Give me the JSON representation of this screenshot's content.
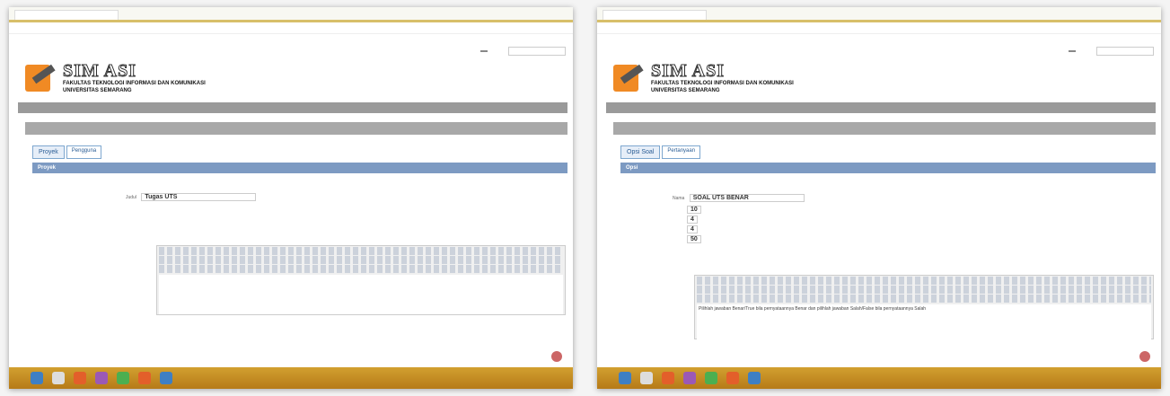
{
  "left": {
    "site_title": "SIM ASI",
    "faculty_line1": "FAKULTAS TEKNOLOGI INFORMASI DAN KOMUNIKASI",
    "faculty_line2": "UNIVERSITAS SEMARANG",
    "section_title": "Proyek",
    "tabs": [
      "Proyek",
      "Pengguna"
    ],
    "fields": {
      "name_label": "Judul",
      "name_value": "Tugas UTS"
    }
  },
  "right": {
    "site_title": "SIM ASI",
    "faculty_line1": "FAKULTAS TEKNOLOGI INFORMASI DAN KOMUNIKASI",
    "faculty_line2": "UNIVERSITAS SEMARANG",
    "section_title": "Opsi",
    "tabs": [
      "Opsi Soal",
      "Pertanyaan"
    ],
    "fields": {
      "name_label": "Nama",
      "name_value": "SOAL UTS BENAR",
      "val1": "10",
      "val2": "4",
      "val3": "4",
      "val4": "50"
    },
    "editor_text": "Pilihlah jawaban Benar/True bila pernyataannya Benar dan pilihlah jawaban Salah/False bila pernyataannya Salah"
  }
}
